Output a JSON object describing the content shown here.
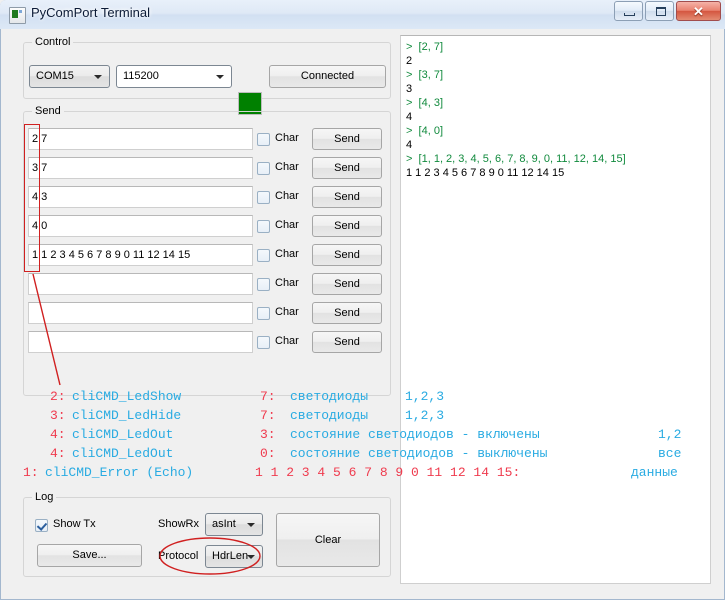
{
  "window": {
    "title": "PyComPort Terminal",
    "icon": "app-icon",
    "buttons": {
      "minimize": "minimize",
      "maximize": "maximize",
      "close": "✕"
    }
  },
  "control": {
    "legend": "Control",
    "port": {
      "value": "COM15",
      "options": [
        "COM15"
      ]
    },
    "baud": {
      "value": "115200",
      "options": [
        "115200"
      ]
    },
    "status_color": "#008000",
    "connect_button": "Connected"
  },
  "send": {
    "legend": "Send",
    "char_label": "Char",
    "send_label": "Send",
    "rows": [
      {
        "value": "2 7",
        "char_checked": false
      },
      {
        "value": "3 7",
        "char_checked": false
      },
      {
        "value": "4 3",
        "char_checked": false
      },
      {
        "value": "4 0",
        "char_checked": false
      },
      {
        "value": "1 1 2 3 4 5 6 7 8 9 0 11 12 14 15",
        "char_checked": false
      },
      {
        "value": "",
        "char_checked": false
      },
      {
        "value": "",
        "char_checked": false
      },
      {
        "value": "",
        "char_checked": false
      }
    ]
  },
  "log": {
    "legend": "Log",
    "show_tx_label": "Show Tx",
    "show_tx_checked": true,
    "show_rx_label": "ShowRx",
    "show_rx": {
      "value": "asInt",
      "options": [
        "asInt"
      ]
    },
    "save_label": "Save...",
    "protocol_label": "Protocol",
    "protocol": {
      "value": "HdrLen",
      "options": [
        "HdrLen"
      ]
    },
    "clear_label": "Clear"
  },
  "terminal": {
    "lines": [
      {
        "kind": "tx",
        "text": ">  [2, 7]"
      },
      {
        "kind": "rx",
        "text": "2"
      },
      {
        "kind": "tx",
        "text": ">  [3, 7]"
      },
      {
        "kind": "rx",
        "text": "3"
      },
      {
        "kind": "tx",
        "text": ">  [4, 3]"
      },
      {
        "kind": "rx",
        "text": "4"
      },
      {
        "kind": "tx",
        "text": ">  [4, 0]"
      },
      {
        "kind": "rx",
        "text": "4"
      },
      {
        "kind": "tx",
        "text": ">  [1, 1, 2, 3, 4, 5, 6, 7, 8, 9, 0, 11, 12, 14, 15]"
      },
      {
        "kind": "rx",
        "text": "1 1 2 3 4 5 6 7 8 9 0 11 12 14 15"
      }
    ]
  },
  "annotations": {
    "colors": {
      "red": "#ef3b4e",
      "blue": "#29abe2",
      "rect": "#d02020"
    },
    "lines": [
      {
        "cmd_num": "2:",
        "cmd_name": "cliCMD_LedShow",
        "arg_num": "7:",
        "arg_name": "светодиоды",
        "tail": "1,2,3"
      },
      {
        "cmd_num": "3:",
        "cmd_name": "cliCMD_LedHide",
        "arg_num": "7:",
        "arg_name": "светодиоды",
        "tail": "1,2,3"
      },
      {
        "cmd_num": "4:",
        "cmd_name": "cliCMD_LedOut",
        "arg_num": "3:",
        "arg_name": "состояние светодиодов - включены",
        "tail": "1,2"
      },
      {
        "cmd_num": "4:",
        "cmd_name": "cliCMD_LedOut",
        "arg_num": "0:",
        "arg_name": "состояние светодиодов - выключены",
        "tail": "все"
      }
    ],
    "error_line": {
      "num": "1:",
      "name": "cliCMD_Error (Echo)",
      "data": "1 1 2 3 4 5 6 7 8 9 0 11 12 14 15:",
      "data_label": "данные"
    }
  }
}
